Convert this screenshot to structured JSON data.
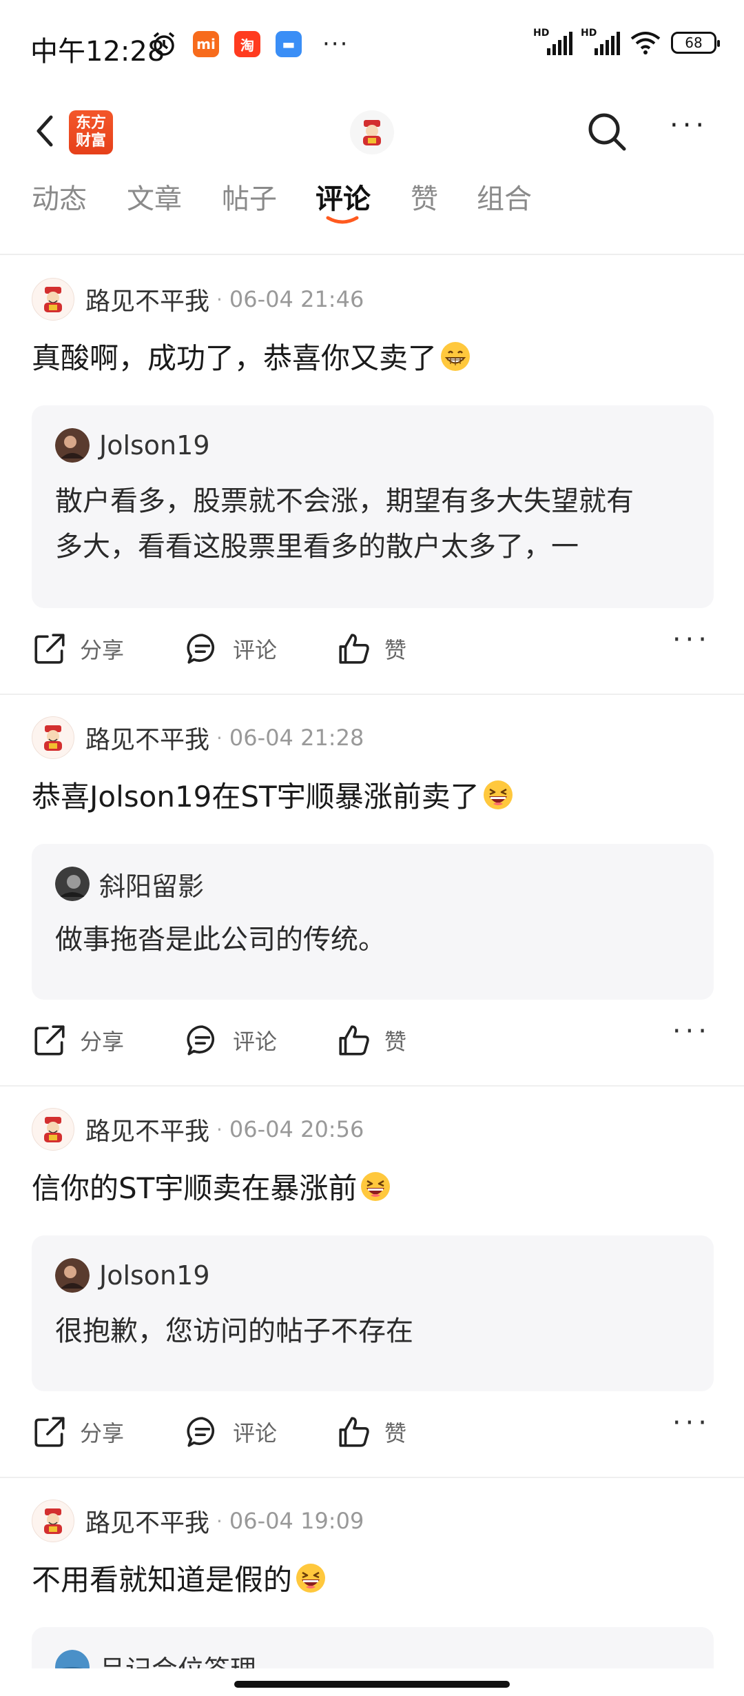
{
  "status_bar": {
    "time": "中午12:28",
    "battery": "68",
    "network": [
      "HD",
      "HD"
    ]
  },
  "header": {
    "brand_line1": "东方",
    "brand_line2": "财富"
  },
  "tabs": [
    {
      "label": "动态"
    },
    {
      "label": "文章"
    },
    {
      "label": "帖子"
    },
    {
      "label": "评论",
      "active": true
    },
    {
      "label": "赞"
    },
    {
      "label": "组合"
    }
  ],
  "comments": [
    {
      "author": "路见不平我",
      "time": "06-04 21:46",
      "text": "真酸啊，成功了，恭喜你又卖了",
      "emoji": "grin-emoji",
      "quote": {
        "author": "Jolson19",
        "text_line1": "散户看多，股票就不会涨，期望有多大失望就有",
        "text_line2": "多大，看看这股票里看多的散户太多了，一"
      },
      "actions": {
        "share": "分享",
        "comment": "评论",
        "like": "赞"
      }
    },
    {
      "author": "路见不平我",
      "time": "06-04 21:28",
      "text": "恭喜Jolson19在ST宇顺暴涨前卖了",
      "emoji": "laugh-emoji",
      "quote": {
        "author": "斜阳留影",
        "text_line1": "做事拖沓是此公司的传统。",
        "text_line2": ""
      },
      "actions": {
        "share": "分享",
        "comment": "评论",
        "like": "赞"
      }
    },
    {
      "author": "路见不平我",
      "time": "06-04 20:56",
      "text": "信你的ST宇顺卖在暴涨前",
      "emoji": "laugh-emoji",
      "quote": {
        "author": "Jolson19",
        "text_line1": "很抱歉，您访问的帖子不存在",
        "text_line2": ""
      },
      "actions": {
        "share": "分享",
        "comment": "评论",
        "like": "赞"
      }
    },
    {
      "author": "路见不平我",
      "time": "06-04 19:09",
      "text": "不用看就知道是假的",
      "emoji": "laugh-emoji",
      "quote": {
        "author": "吕记会位答理",
        "text_line1": "",
        "text_line2": ""
      }
    }
  ],
  "colors": {
    "accent": "#f25022",
    "tab_underline": "#ff5a1f",
    "quote_bg": "#f6f6f8"
  }
}
